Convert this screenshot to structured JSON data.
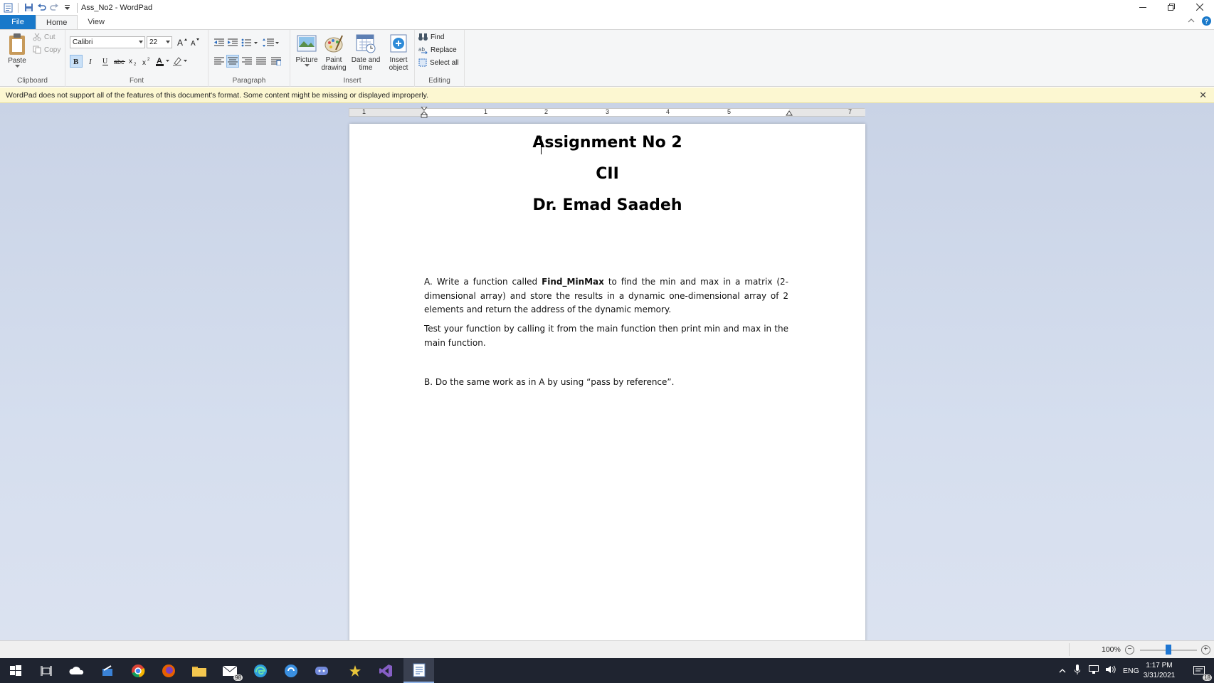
{
  "window": {
    "title": "Ass_No2 - WordPad"
  },
  "tabs": [
    {
      "label": "File"
    },
    {
      "label": "Home"
    },
    {
      "label": "View"
    }
  ],
  "ribbon": {
    "clipboard": {
      "group_label": "Clipboard",
      "paste": "Paste",
      "cut": "Cut",
      "copy": "Copy"
    },
    "font": {
      "group_label": "Font",
      "font_name": "Calibri",
      "font_size": "22"
    },
    "paragraph": {
      "group_label": "Paragraph"
    },
    "insert": {
      "group_label": "Insert",
      "picture": "Picture",
      "paint_line1": "Paint",
      "paint_line2": "drawing",
      "datetime_line1": "Date and",
      "datetime_line2": "time",
      "object_line1": "Insert",
      "object_line2": "object"
    },
    "editing": {
      "group_label": "Editing",
      "find": "Find",
      "replace": "Replace",
      "select_all": "Select all"
    }
  },
  "infobar": {
    "message": "WordPad does not support all of the features of this document's format. Some content might be missing or displayed improperly."
  },
  "ruler": {
    "numbers": [
      "1",
      "1",
      "2",
      "3",
      "4",
      "5",
      "7"
    ]
  },
  "document": {
    "heading1": "Assignment No 2",
    "heading2": "CII",
    "heading3": "Dr. Emad Saadeh",
    "para_a_prefix": "A. Write a function called ",
    "para_a_bold": "Find_MinMax",
    "para_a_suffix": " to find the min and max in a matrix (2-dimensional array) and store the results in a dynamic one-dimensional array of 2 elements and return the address of the dynamic memory.",
    "para_test": "Test your function by calling it from the main function then print min and max in the main function.",
    "para_b": "B. Do the same work as in A by using “pass by reference”."
  },
  "statusbar": {
    "zoom": "100%",
    "zoom_minus": "−",
    "zoom_plus": "+",
    "zoom_level_pct": 50
  },
  "taskbar": {
    "mail_badge": "98",
    "language": "ENG",
    "time": "1:17 PM",
    "date": "3/31/2021",
    "notification_count": "18"
  },
  "colors": {
    "accent": "#1979ca",
    "infobar": "#fcf7d1",
    "taskbar": "#1f2430"
  }
}
